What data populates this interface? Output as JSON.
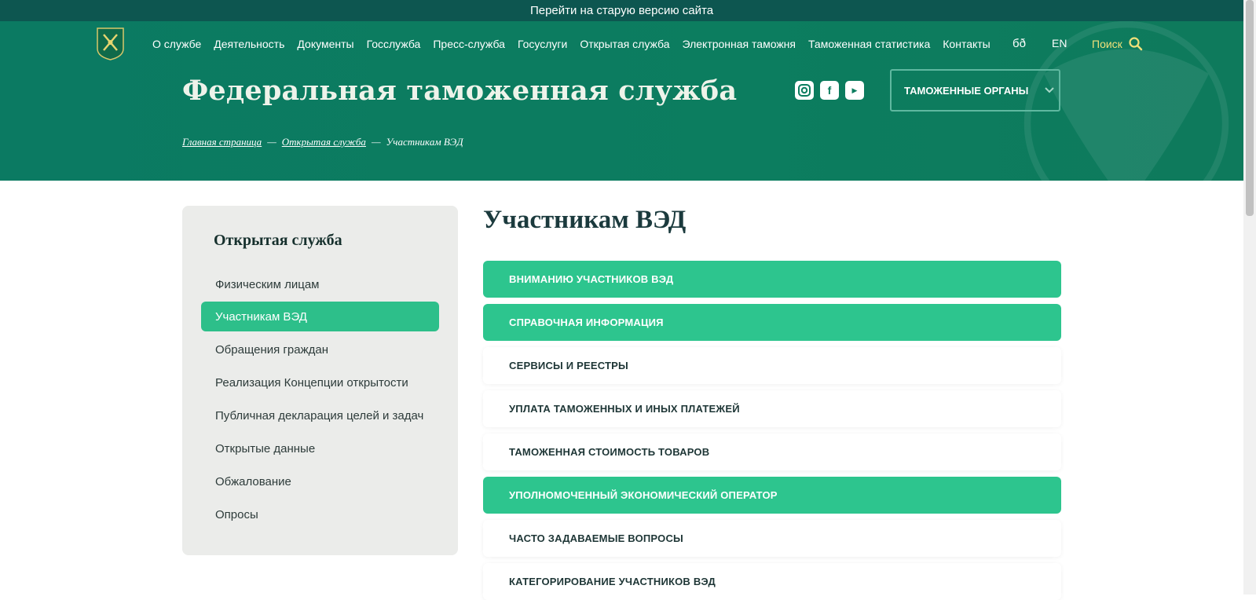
{
  "topbar": {
    "text": "Перейти на старую версию сайта"
  },
  "nav": {
    "items": [
      "О службе",
      "Деятельность",
      "Документы",
      "Госслужба",
      "Пресс-служба",
      "Госуслуги",
      "Открытая служба",
      "Электронная таможня",
      "Таможенная статистика",
      "Контакты"
    ],
    "accessibility_glyph": "бð",
    "lang": "EN",
    "search_label": "Поиск"
  },
  "header": {
    "title": "Федеральная таможенная служба",
    "dept_button": "ТАМОЖЕННЫЕ ОРГАНЫ",
    "social": [
      "instagram-icon",
      "facebook-icon",
      "youtube-icon"
    ]
  },
  "breadcrumb": {
    "home": "Главная страница",
    "section": "Открытая служба",
    "current": "Участникам ВЭД",
    "sep": "—"
  },
  "sidebar": {
    "title": "Открытая служба",
    "items": [
      "Физическим лицам",
      "Участникам ВЭД",
      "Обращения граждан",
      "Реализация Концепции открытости",
      "Публичная декларация целей и задач",
      "Открытые данные",
      "Обжалование",
      "Опросы"
    ],
    "active_index": 1
  },
  "main": {
    "heading": "Участникам ВЭД",
    "sections": [
      {
        "label": "ВНИМАНИЮ УЧАСТНИКОВ ВЭД",
        "highlighted": true
      },
      {
        "label": "СПРАВОЧНАЯ ИНФОРМАЦИЯ",
        "highlighted": true
      },
      {
        "label": "СЕРВИСЫ И РЕЕСТРЫ",
        "highlighted": false
      },
      {
        "label": "УПЛАТА ТАМОЖЕННЫХ И ИНЫХ ПЛАТЕЖЕЙ",
        "highlighted": false
      },
      {
        "label": "ТАМОЖЕННАЯ СТОИМОСТЬ ТОВАРОВ",
        "highlighted": false
      },
      {
        "label": "УПОЛНОМОЧЕННЫЙ ЭКОНОМИЧЕСКИЙ ОПЕРАТОР",
        "highlighted": true
      },
      {
        "label": "ЧАСТО ЗАДАВАЕМЫЕ ВОПРОСЫ",
        "highlighted": false
      },
      {
        "label": "КАТЕГОРИРОВАНИЕ УЧАСТНИКОВ ВЭД",
        "highlighted": false
      }
    ]
  },
  "colors": {
    "header_green": "#0c7d5f",
    "accent_green": "#2dc58e",
    "topbar": "#0d5650"
  }
}
